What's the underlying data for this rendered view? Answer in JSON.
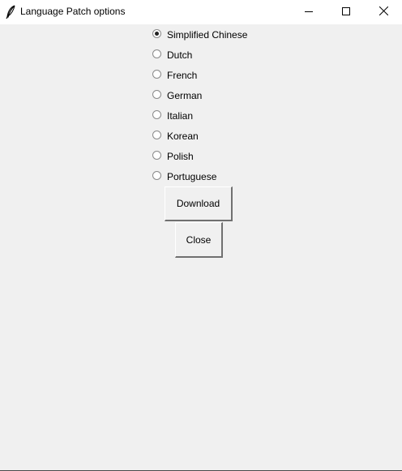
{
  "window": {
    "title": "Language Patch options",
    "icons": {
      "app": "feather-icon",
      "minimize": "minimize-icon",
      "maximize": "maximize-icon",
      "close": "close-icon"
    }
  },
  "language_options": {
    "selected": "Simplified Chinese",
    "items": [
      {
        "label": "Simplified Chinese",
        "checked": true
      },
      {
        "label": "Dutch",
        "checked": false
      },
      {
        "label": "French",
        "checked": false
      },
      {
        "label": "German",
        "checked": false
      },
      {
        "label": "Italian",
        "checked": false
      },
      {
        "label": "Korean",
        "checked": false
      },
      {
        "label": "Polish",
        "checked": false
      },
      {
        "label": "Portuguese",
        "checked": false
      }
    ]
  },
  "buttons": {
    "download_label": "Download",
    "close_label": "Close"
  },
  "colors": {
    "background": "#f0f0f0",
    "titlebar": "#ffffff"
  }
}
